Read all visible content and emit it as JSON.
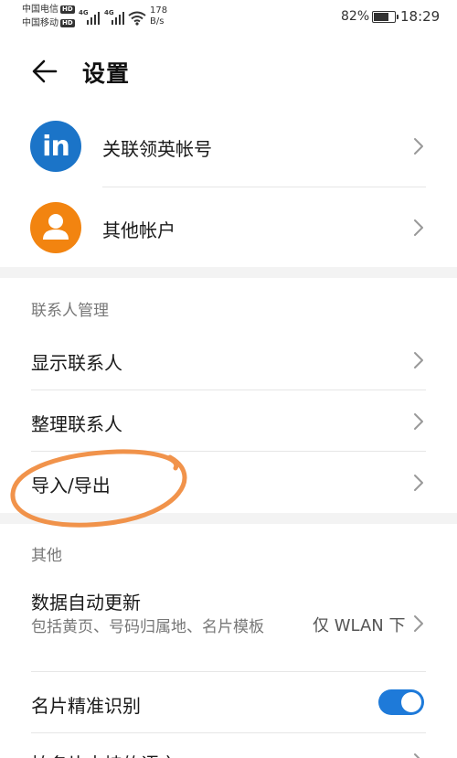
{
  "status_bar": {
    "carrier_1": "中国电信",
    "carrier_2": "中国移动",
    "hd": "HD",
    "net_type": "4G",
    "speed_value": "178",
    "speed_unit": "B/s",
    "battery_percent": "82%",
    "battery_level": 0.82,
    "time": "18:29"
  },
  "header": {
    "title": "设置"
  },
  "accounts": {
    "linkedin_logo": "in",
    "linkedin_label": "关联领英帐号",
    "other_label": "其他帐户"
  },
  "contacts_section": {
    "title": "联系人管理",
    "items": [
      {
        "label": "显示联系人"
      },
      {
        "label": "整理联系人"
      },
      {
        "label": "导入/导出"
      }
    ]
  },
  "other_section": {
    "title": "其他",
    "auto_update": {
      "label": "数据自动更新",
      "description": "包括黄页、号码归属地、名片模板",
      "value": "仅 WLAN 下"
    },
    "card_recognition": {
      "label": "名片精准识别",
      "enabled": true
    },
    "partial_item": {
      "label": "拍名片支持的语言"
    }
  },
  "colors": {
    "accent": "#1e7ad9",
    "linkedin": "#1b74c8",
    "avatar_orange": "#f28410",
    "annotation": "#f08a3c"
  },
  "icons": [
    "back-arrow-icon",
    "linkedin-icon",
    "person-icon",
    "chevron-right-icon",
    "wifi-icon",
    "signal-icon",
    "battery-icon"
  ]
}
